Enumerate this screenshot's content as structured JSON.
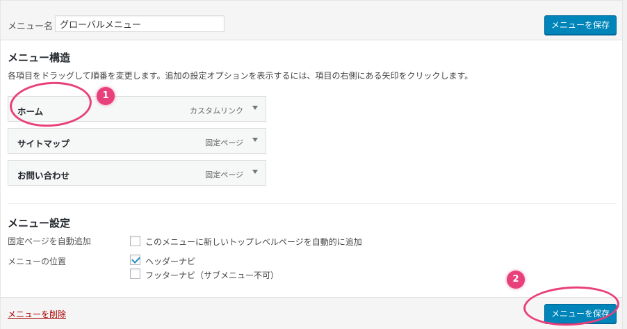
{
  "header": {
    "menu_name_label": "メニュー名",
    "menu_name_value": "グローバルメニュー",
    "save_label": "メニューを保存"
  },
  "structure": {
    "title": "メニュー構造",
    "instruction": "各項目をドラッグして順番を変更します。追加の設定オプションを表示するには、項目の右側にある矢印をクリックします。",
    "items": [
      {
        "title": "ホーム",
        "type": "カスタムリンク"
      },
      {
        "title": "サイトマップ",
        "type": "固定ページ"
      },
      {
        "title": "お問い合わせ",
        "type": "固定ページ"
      }
    ]
  },
  "settings": {
    "title": "メニュー設定",
    "auto_add_label": "固定ページを自動追加",
    "auto_add_option": "このメニューに新しいトップレベルページを自動的に追加",
    "auto_add_checked": false,
    "location_label": "メニューの位置",
    "locations": [
      {
        "label": "ヘッダーナビ",
        "checked": true
      },
      {
        "label": "フッターナビ（サブメニュー不可）",
        "checked": false
      }
    ]
  },
  "footer": {
    "delete_label": "メニューを削除",
    "save_label": "メニューを保存"
  },
  "annotations": {
    "badge_1": "1",
    "badge_2": "2",
    "color": "#e8407a"
  },
  "colors": {
    "primary_button": "#0085ba",
    "delete_link": "#aa0000"
  }
}
